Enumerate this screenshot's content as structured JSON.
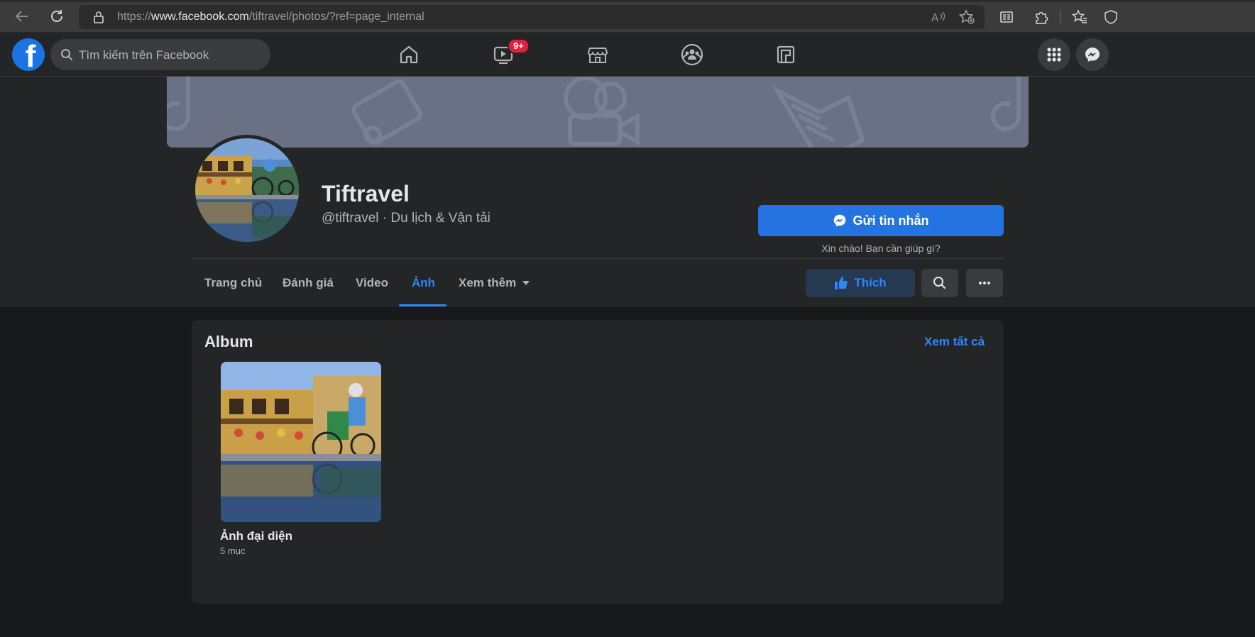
{
  "browser": {
    "url_prefix": "https://",
    "url_domain": "www.facebook.com",
    "url_path": "/tiftravel/photos/?ref=page_internal"
  },
  "fb_nav": {
    "logo_letter": "f",
    "search_placeholder": "Tìm kiếm trên Facebook",
    "watch_badge": "9+"
  },
  "page": {
    "name": "Tiftravel",
    "handle_category": "@tiftravel · Du lịch & Vận tải",
    "message_button": "Gửi tin nhắn",
    "message_hint": "Xin chào! Bạn cần giúp gì?",
    "like_button": "Thích"
  },
  "tabs": [
    {
      "label": "Trang chủ",
      "active": false
    },
    {
      "label": "Đánh giá",
      "active": false
    },
    {
      "label": "Video",
      "active": false
    },
    {
      "label": "Ảnh",
      "active": true
    },
    {
      "label": "Xem thêm",
      "active": false
    }
  ],
  "album_section": {
    "title": "Album",
    "see_all": "Xem tất cả",
    "albums": [
      {
        "name": "Ảnh đại diện",
        "count": "5 mục"
      }
    ]
  },
  "colors": {
    "accent": "#2d88ff",
    "primary_button": "#2374e1",
    "badge": "#e41e3f"
  }
}
